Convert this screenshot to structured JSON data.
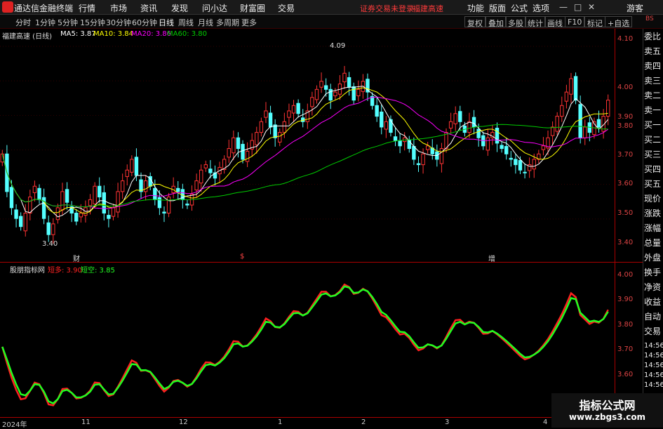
{
  "app": {
    "title": "通达信金融终端",
    "menus": [
      "行情",
      "市场",
      "资讯",
      "发现",
      "问小达",
      "财富圈",
      "交易"
    ],
    "status_text": "证券交易未登录",
    "stock_name": "福建高速",
    "right_menus": [
      "功能",
      "版面",
      "公式",
      "选项"
    ],
    "user": "游客",
    "win_buttons": [
      "—",
      "□",
      "✕"
    ]
  },
  "toolbar": {
    "periods": [
      "分时",
      "1分钟",
      "5分钟",
      "15分钟",
      "30分钟",
      "60分钟",
      "日线",
      "周线",
      "月线",
      "多周期",
      "更多"
    ],
    "selected": "日线",
    "right_buttons": [
      "复权",
      "叠加",
      "多股",
      "统计",
      "画线",
      "F10",
      "标记",
      "+自选"
    ]
  },
  "main_chart": {
    "title": "福建高速 (日线)",
    "legend": [
      {
        "name": "MA5: 3.87",
        "color": "#ffffff"
      },
      {
        "name": "MA10: 3.84",
        "color": "#ffff00"
      },
      {
        "name": "MA20: 3.86",
        "color": "#ff00ff"
      },
      {
        "name": "MA60: 3.80",
        "color": "#00cc00"
      }
    ],
    "high_label": "4.09",
    "low_label": "3.40",
    "markers": [
      "财",
      "$",
      "增"
    ],
    "y_ticks": [
      "4.10",
      "4.00",
      "3.90",
      "3.80",
      "3.70",
      "3.60",
      "3.50",
      "3.40"
    ]
  },
  "indicator": {
    "name": "股朋指标网",
    "series": [
      {
        "name": "短多: 3.90",
        "color": "#ff2020"
      },
      {
        "name": "短空: 3.85",
        "color": "#20ff20"
      }
    ],
    "y_ticks": [
      "4.00",
      "3.90",
      "3.80",
      "3.70",
      "3.60"
    ]
  },
  "side_panel": {
    "top_label": "BS",
    "labels": [
      "委比",
      "卖五",
      "卖四",
      "卖三",
      "卖二",
      "卖一",
      "买一",
      "买二",
      "买三",
      "买四",
      "买五",
      "现价",
      "涨跌",
      "涨幅",
      "总量",
      "外盘",
      "换手",
      "净资",
      "收益",
      "自动",
      "交易"
    ],
    "times": [
      "14:56",
      "14:56",
      "14:56",
      "14:56",
      "14:56",
      "14:56",
      "14:56",
      "14:56",
      "14:56"
    ]
  },
  "date_axis": [
    "2024年",
    "11",
    "12",
    "1",
    "2",
    "3",
    "4"
  ],
  "watermark": {
    "title": "指标公式网",
    "url": "www.zbgs3.com"
  },
  "chart_data": {
    "type": "candlestick",
    "y_range": [
      3.35,
      4.12
    ],
    "close": [
      3.72,
      3.58,
      3.52,
      3.48,
      3.45,
      3.5,
      3.56,
      3.6,
      3.55,
      3.48,
      3.42,
      3.46,
      3.52,
      3.58,
      3.54,
      3.5,
      3.47,
      3.5,
      3.52,
      3.55,
      3.6,
      3.56,
      3.5,
      3.48,
      3.52,
      3.58,
      3.62,
      3.66,
      3.7,
      3.64,
      3.58,
      3.62,
      3.6,
      3.55,
      3.52,
      3.5,
      3.56,
      3.6,
      3.58,
      3.55,
      3.53,
      3.57,
      3.62,
      3.66,
      3.68,
      3.65,
      3.63,
      3.67,
      3.7,
      3.74,
      3.78,
      3.74,
      3.7,
      3.73,
      3.77,
      3.8,
      3.84,
      3.88,
      3.82,
      3.78,
      3.8,
      3.84,
      3.88,
      3.9,
      3.87,
      3.84,
      3.88,
      3.93,
      3.96,
      3.99,
      3.96,
      3.92,
      3.95,
      3.98,
      4.02,
      3.97,
      3.92,
      3.96,
      3.99,
      3.95,
      3.9,
      3.86,
      3.82,
      3.84,
      3.8,
      3.77,
      3.75,
      3.78,
      3.74,
      3.7,
      3.68,
      3.72,
      3.75,
      3.72,
      3.7,
      3.74,
      3.8,
      3.84,
      3.87,
      3.84,
      3.8,
      3.84,
      3.82,
      3.78,
      3.75,
      3.78,
      3.8,
      3.76,
      3.74,
      3.72,
      3.7,
      3.68,
      3.66,
      3.65,
      3.68,
      3.7,
      3.72,
      3.75,
      3.78,
      3.82,
      3.86,
      3.9,
      3.95,
      4.0,
      3.92,
      3.78,
      3.82,
      3.8,
      3.84,
      3.82,
      3.86,
      3.92
    ],
    "ma_series": [
      {
        "name": "MA5",
        "color": "#ffffff"
      },
      {
        "name": "MA10",
        "color": "#ffff00"
      },
      {
        "name": "MA20",
        "color": "#ff00ff"
      },
      {
        "name": "MA60",
        "color": "#00cc00"
      }
    ]
  }
}
